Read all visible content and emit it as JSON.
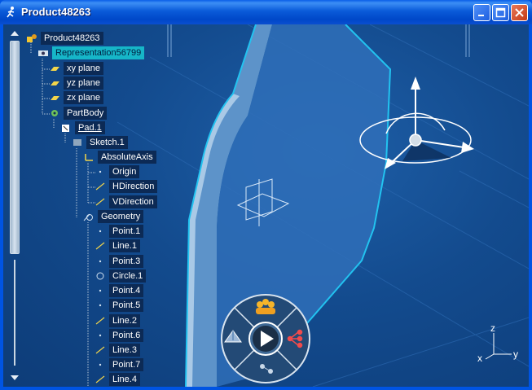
{
  "window": {
    "title": "Product48263",
    "icon": "catia-run-icon",
    "buttons": [
      "minimize-icon",
      "maximize-icon",
      "close-icon"
    ]
  },
  "tree": {
    "nodes": [
      {
        "label": "Product48263",
        "icon": "product-icon"
      },
      {
        "label": "Representation56799",
        "icon": "representation-icon",
        "selected": true
      },
      {
        "label": "xy plane",
        "icon": "plane-icon"
      },
      {
        "label": "yz plane",
        "icon": "plane-icon"
      },
      {
        "label": "zx plane",
        "icon": "plane-icon"
      },
      {
        "label": "PartBody",
        "icon": "gear-icon"
      },
      {
        "label": "Pad.1",
        "icon": "pad-icon",
        "underlined": true
      },
      {
        "label": "Sketch.1",
        "icon": "sketch-icon"
      },
      {
        "label": "AbsoluteAxis",
        "icon": "axis-icon"
      },
      {
        "label": "Origin",
        "icon": "point-icon"
      },
      {
        "label": "HDirection",
        "icon": "line-icon"
      },
      {
        "label": "VDirection",
        "icon": "line-icon"
      },
      {
        "label": "Geometry",
        "icon": "geometry-icon"
      },
      {
        "label": "Point.1",
        "icon": "point-icon"
      },
      {
        "label": "Line.1",
        "icon": "line-icon"
      },
      {
        "label": "Point.3",
        "icon": "point-icon"
      },
      {
        "label": "Circle.1",
        "icon": "circle-icon"
      },
      {
        "label": "Point.4",
        "icon": "point-icon"
      },
      {
        "label": "Point.5",
        "icon": "point-icon"
      },
      {
        "label": "Line.2",
        "icon": "line-icon"
      },
      {
        "label": "Point.6",
        "icon": "point-icon"
      },
      {
        "label": "Line.3",
        "icon": "line-icon"
      },
      {
        "label": "Point.7",
        "icon": "point-icon"
      },
      {
        "label": "Line.4",
        "icon": "line-icon"
      }
    ]
  },
  "viewer": {
    "axis_labels": {
      "z": "z",
      "x": "x",
      "y": "y"
    },
    "colors": {
      "background": "#134b8e",
      "highlight": "#22c3f0",
      "panel": "#2f7ad0"
    }
  },
  "navigation_widget": {
    "center": "play-icon",
    "top": "collaboration-icon",
    "left": "3d-object-icon",
    "right": "tree-structure-icon",
    "bottom": "relations-icon"
  }
}
